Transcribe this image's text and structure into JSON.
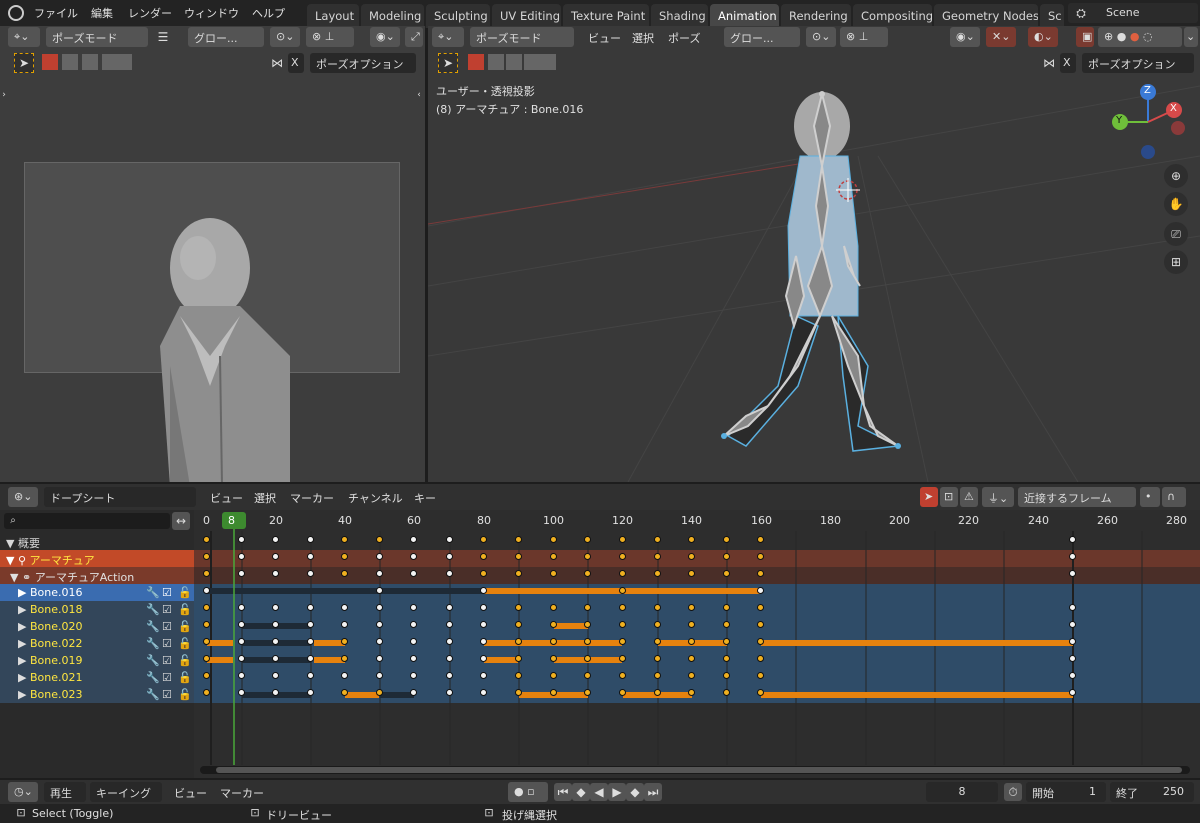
{
  "topbar": {
    "menus": [
      "ファイル",
      "編集",
      "レンダー",
      "ウィンドウ",
      "ヘルプ"
    ],
    "workspaces": [
      {
        "label": "Layout",
        "active": false
      },
      {
        "label": "Modeling",
        "active": false
      },
      {
        "label": "Sculpting",
        "active": false
      },
      {
        "label": "UV Editing",
        "active": false
      },
      {
        "label": "Texture Paint",
        "active": false
      },
      {
        "label": "Shading",
        "active": false
      },
      {
        "label": "Animation",
        "active": true
      },
      {
        "label": "Rendering",
        "active": false
      },
      {
        "label": "Compositing",
        "active": false
      },
      {
        "label": "Geometry Nodes",
        "active": false
      },
      {
        "label": "Sc",
        "active": false
      }
    ],
    "scene": "Scene"
  },
  "left_viewport": {
    "mode": "ポーズモード",
    "transform": "グロー...",
    "pose_options": "ポーズオプション",
    "x_label": "X"
  },
  "right_viewport": {
    "mode": "ポーズモード",
    "menus": [
      "ビュー",
      "選択",
      "ポーズ"
    ],
    "transform": "グロー...",
    "pose_options": "ポーズオプション",
    "x_label": "X",
    "overlay_line1": "ユーザー・透視投影",
    "overlay_line2": "(8) アーマチュア : Bone.016",
    "gizmo": {
      "z": "Z",
      "y": "Y",
      "x": "X"
    }
  },
  "dopesheet": {
    "editor": "ドープシート",
    "menus": [
      "ビュー",
      "選択",
      "マーカー",
      "チャンネル",
      "キー"
    ],
    "snap": "近接するフレーム",
    "current_frame": "8",
    "ruler": [
      "0",
      "20",
      "40",
      "60",
      "80",
      "100",
      "120",
      "140",
      "160",
      "180",
      "200",
      "220",
      "240",
      "260",
      "280"
    ],
    "channels": [
      {
        "label": "概要",
        "type": "summary"
      },
      {
        "label": "アーマチュア",
        "type": "object"
      },
      {
        "label": "アーマチュアAction",
        "type": "action"
      },
      {
        "label": "Bone.016",
        "type": "bone",
        "selected": true
      },
      {
        "label": "Bone.018",
        "type": "bone"
      },
      {
        "label": "Bone.020",
        "type": "bone"
      },
      {
        "label": "Bone.022",
        "type": "bone"
      },
      {
        "label": "Bone.019",
        "type": "bone"
      },
      {
        "label": "Bone.021",
        "type": "bone"
      },
      {
        "label": "Bone.023",
        "type": "bone"
      }
    ]
  },
  "playback": {
    "play_menu": "再生",
    "keying_menu": "キーイング",
    "view_menu": "ビュー",
    "marker_menu": "マーカー",
    "frame": "8",
    "start_label": "開始",
    "start_value": "1",
    "end_label": "終了",
    "end_value": "250"
  },
  "statusbar": {
    "left": "Select (Toggle)",
    "mid": "ドリービュー",
    "right": "投げ縄選択"
  },
  "colors": {
    "accent_blue": "#4772b3",
    "keyframe_orange": "#e6820e",
    "playhead_green": "#3d8a2f",
    "object_row": "#8b3a2a"
  }
}
